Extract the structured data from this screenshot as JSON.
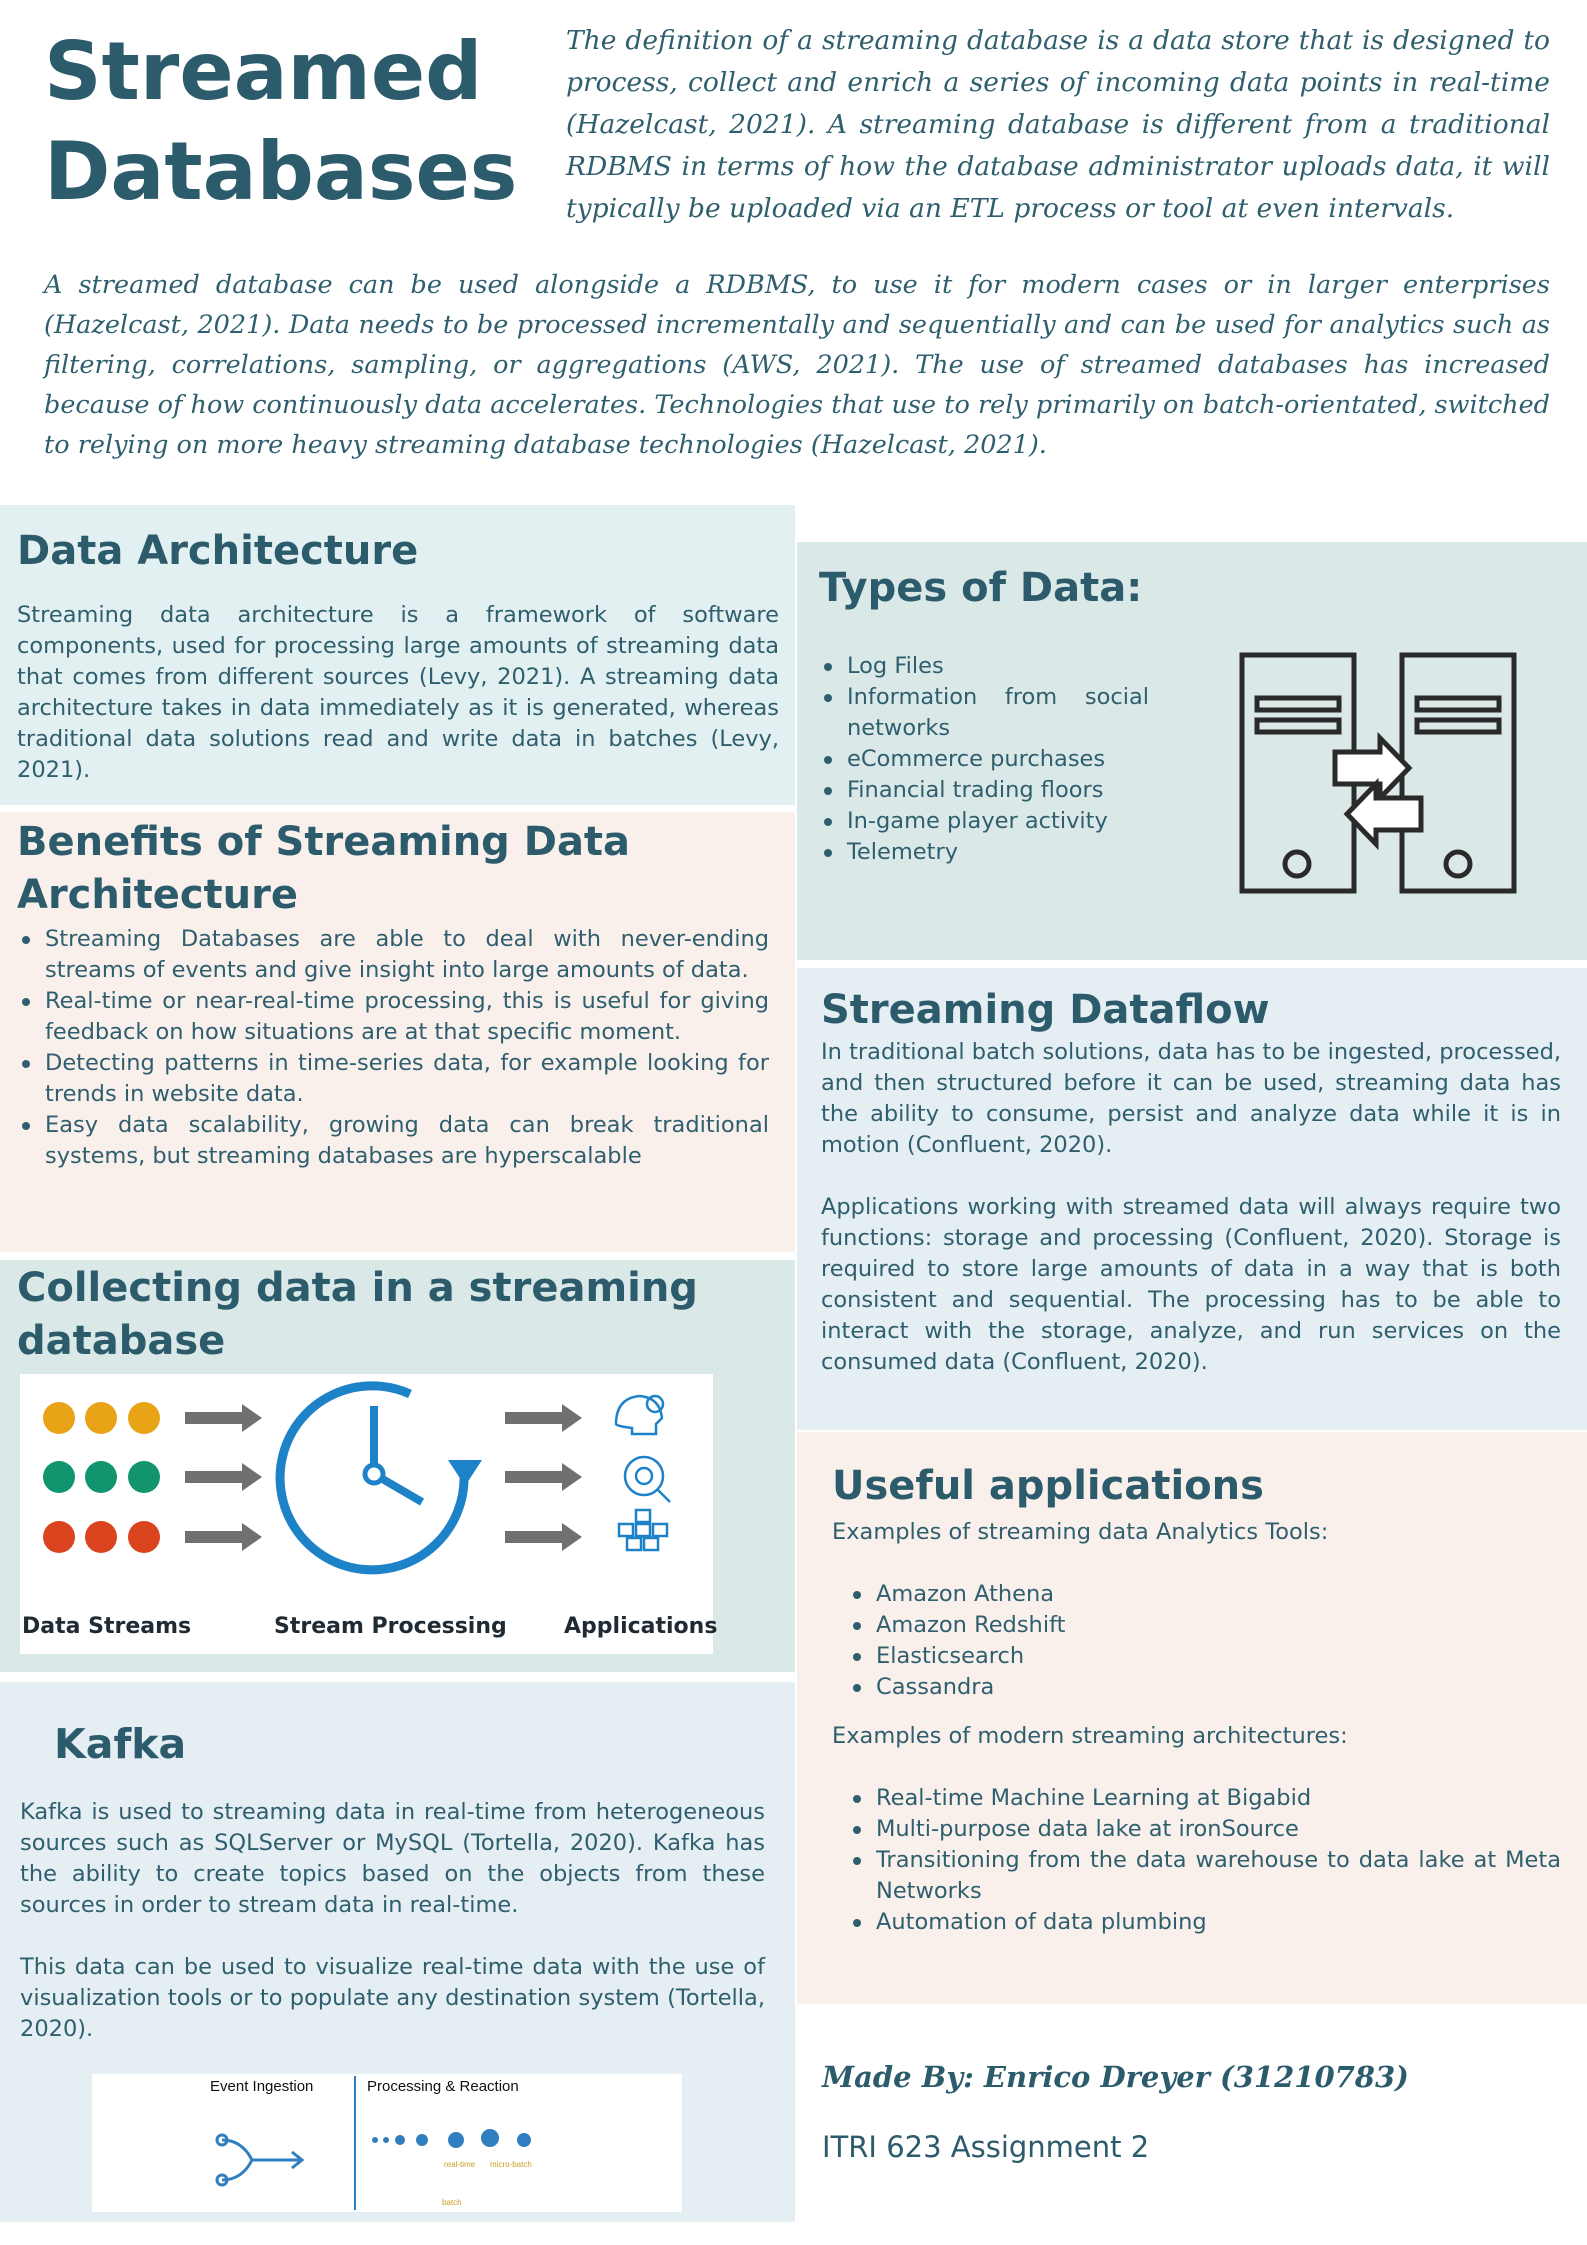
{
  "header": {
    "title_line1": "Streamed",
    "title_line2": "Databases",
    "intro": "The definition of a streaming database is a data store that is designed to process, collect and enrich a series of incoming data points in real-time (Hazelcast, 2021). A streaming database is different from a traditional RDBMS in terms of how the database administrator uploads data, it will typically be uploaded via an ETL process or tool at even intervals.",
    "intro2": "A streamed database can be used alongside a RDBMS, to use it for modern cases or in larger enterprises (Hazelcast, 2021). Data needs to be processed incrementally and sequentially and can be used for analytics such as filtering, correlations, sampling, or aggregations (AWS, 2021). The use of streamed databases has increased because of how continuously data accelerates. Technologies that use to rely primarily on batch-orientated, switched to relying on more heavy streaming database technologies (Hazelcast, 2021)."
  },
  "data_architecture": {
    "heading": "Data Architecture",
    "body": "Streaming data architecture is a framework of software components, used for processing large amounts of streaming data that comes from different sources (Levy, 2021).  A streaming data architecture takes in data immediately as it is generated, whereas traditional data solutions read and write data in batches (Levy, 2021)."
  },
  "benefits": {
    "heading": "Benefits of Streaming Data Architecture",
    "items": [
      "Streaming Databases are able to deal with never-ending streams of events and give insight into large amounts of data.",
      "Real-time or near-real-time processing, this is useful for giving feedback on how situations are at that specific moment.",
      "Detecting patterns in time-series data, for example looking for trends in website data.",
      "Easy data scalability, growing data can break traditional systems, but streaming databases are hyperscalable"
    ]
  },
  "collecting": {
    "heading": "Collecting data in a streaming database",
    "caption_streams": "Data Streams",
    "caption_processing": "Stream Processing",
    "caption_applications": "Applications",
    "dot_colors": [
      "#e8a317",
      "#12956e",
      "#d9441f"
    ],
    "accent_color": "#1e82c8"
  },
  "kafka": {
    "heading": "Kafka",
    "para1": "Kafka is used to streaming data in real-time from heterogeneous sources such as SQLServer or MySQL (Tortella, 2020). Kafka has the ability to create topics based on the objects from these sources in order to stream data in real-time.",
    "para2": "This data can be used to visualize real-time data with the use of visualization tools or to populate any destination system (Tortella, 2020).",
    "diagram_label_ingestion": "Event Ingestion",
    "diagram_label_processing": "Processing & Reaction",
    "diagram_label_realtime": "real-time",
    "diagram_label_microbatch": "micro-batch",
    "diagram_label_batch": "batch"
  },
  "types": {
    "heading": "Types of Data:",
    "items": [
      "Log Files",
      "Information from social networks",
      "eCommerce purchases",
      "Financial trading floors",
      "In-game player activity",
      "Telemetry"
    ]
  },
  "dataflow": {
    "heading": "Streaming Dataflow",
    "para1": "In traditional batch solutions, data has to be ingested, processed, and then structured before it can be used, streaming data has the ability to consume, persist and analyze data while it is in motion (Confluent, 2020).",
    "para2": "Applications working with streamed data will always require two functions: storage and processing (Confluent, 2020). Storage is required to store large amounts of data in a way that is both consistent and sequential. The processing has to be able to interact with the storage, analyze, and run services on the consumed data (Confluent, 2020)."
  },
  "applications": {
    "heading": "Useful applications",
    "tools_intro": "Examples of streaming data Analytics Tools:",
    "tools": [
      "Amazon Athena",
      "Amazon Redshift",
      "Elasticsearch",
      "Cassandra"
    ],
    "arch_intro": "Examples of modern streaming architectures:",
    "archs": [
      "Real-time Machine Learning at Bigabid",
      "Multi-purpose data lake at ironSource",
      "Transitioning from the data warehouse to data lake at Meta Networks",
      "Automation of data plumbing"
    ]
  },
  "footer": {
    "made_by": "Made By: Enrico Dreyer (31210783)",
    "assignment": "ITRI 623 Assignment 2"
  }
}
